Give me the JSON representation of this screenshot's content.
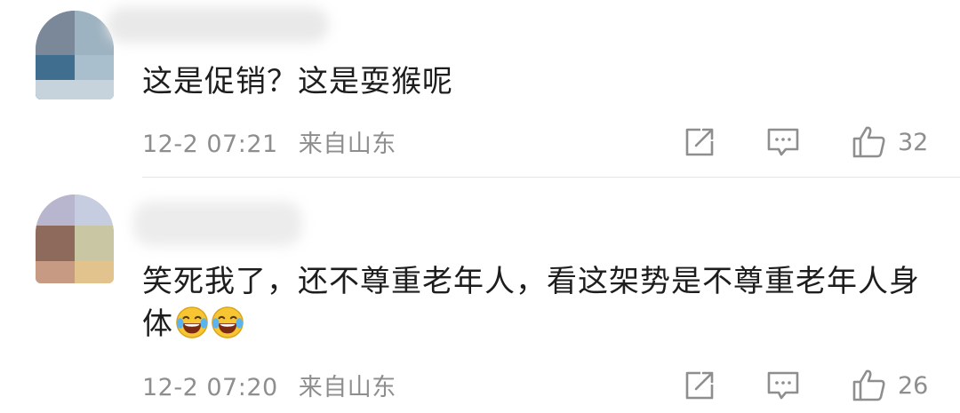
{
  "comments": [
    {
      "text": "这是促销？这是耍猴呢",
      "time": "12-2 07:21",
      "location": "来自山东",
      "like_count": "32"
    },
    {
      "text": "笑死我了，还不尊重老年人，看这架势是不尊重老年人身体",
      "time": "12-2 07:20",
      "location": "来自山东",
      "like_count": "26",
      "emojis": [
        "laughing-tears-emoji",
        "laughing-tears-emoji"
      ]
    }
  ],
  "icons": {
    "share": "share-icon",
    "reply": "comment-icon",
    "like": "thumbs-up-icon"
  },
  "colors": {
    "text": "#1d1d1d",
    "meta": "#8e8e8e",
    "emoji_face": "#f7c531"
  }
}
